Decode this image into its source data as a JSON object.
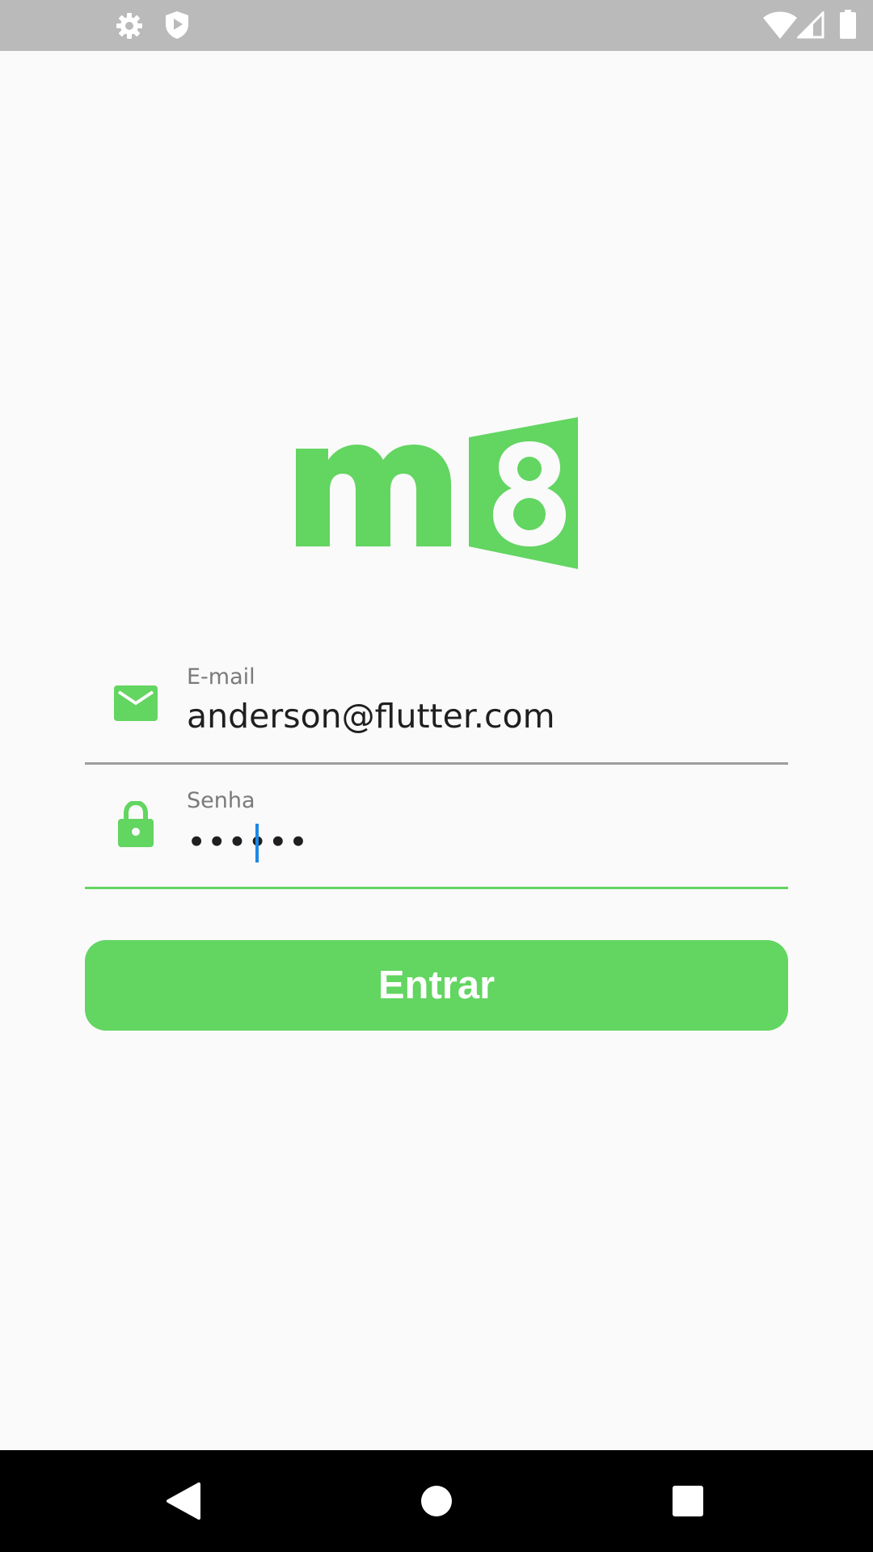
{
  "status_bar": {
    "left_icons": [
      "gear-icon",
      "shield-play-icon"
    ],
    "right_icons": [
      "wifi-icon",
      "signal-icon",
      "battery-icon"
    ]
  },
  "logo": {
    "text": "m8",
    "color": "#63d561"
  },
  "form": {
    "email": {
      "label": "E-mail",
      "value": "anderson@flutter.com",
      "icon": "mail-icon"
    },
    "password": {
      "label": "Senha",
      "value": "••••••",
      "icon": "lock-icon"
    },
    "submit_label": "Entrar"
  },
  "colors": {
    "accent": "#63d561",
    "caret": "#1e88e5",
    "background": "#fafafa",
    "status_bar": "#bababa"
  },
  "nav_bar": {
    "buttons": [
      "back-icon",
      "home-icon",
      "recents-icon"
    ]
  }
}
